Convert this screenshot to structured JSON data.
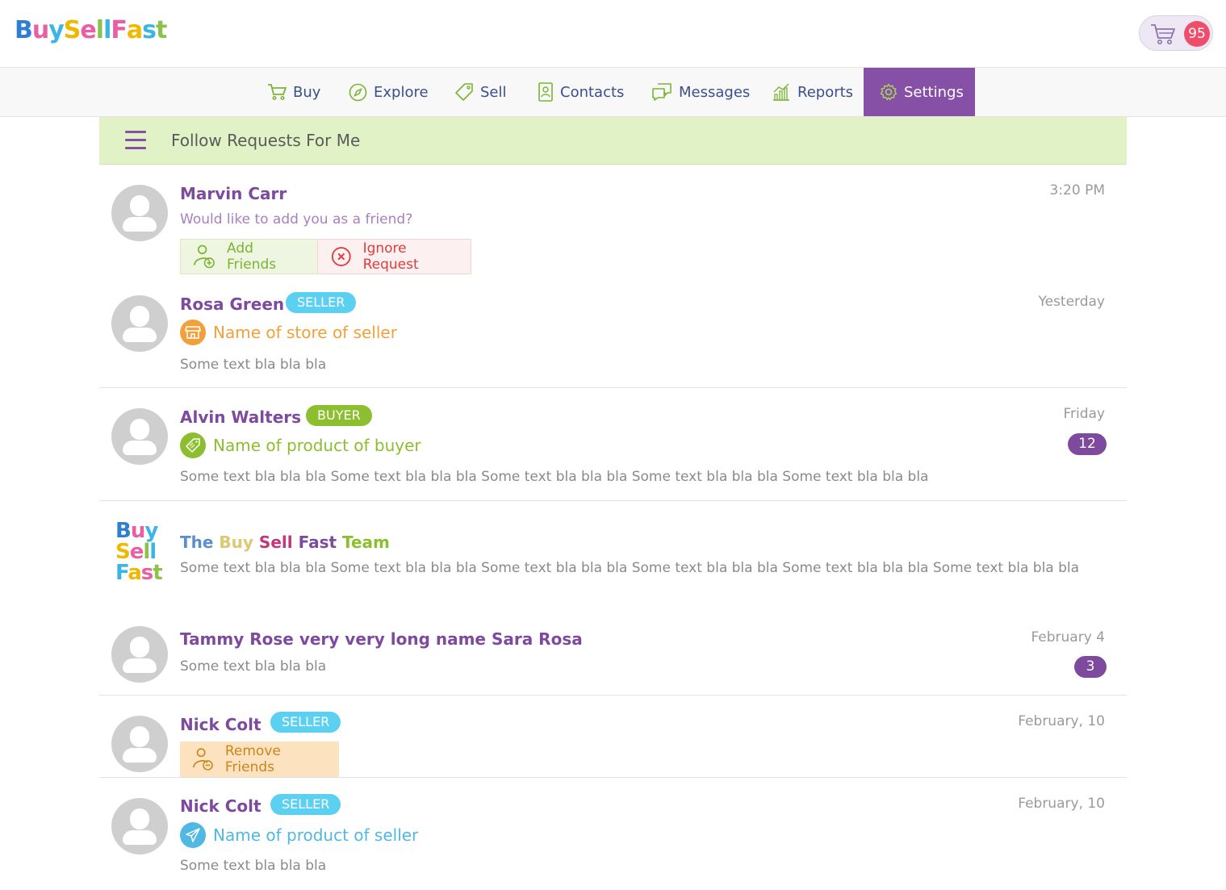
{
  "header": {
    "logo": [
      "B",
      "u",
      "y",
      "S",
      "e",
      "l",
      "l",
      "F",
      "a",
      "s",
      "t"
    ],
    "logo_colors": [
      "#2e7fd2",
      "#e85fa3",
      "#3ab6e6",
      "#f0b800",
      "#e85fa3",
      "#8bc34a",
      "#3ab6e6",
      "#e85fa3",
      "#f0b800",
      "#3ab6e6",
      "#8bc34a"
    ],
    "cart_count": "95"
  },
  "nav": {
    "items": [
      {
        "label": "Buy",
        "icon": "cart-icon"
      },
      {
        "label": "Explore",
        "icon": "compass-icon"
      },
      {
        "label": "Sell",
        "icon": "tag-icon"
      },
      {
        "label": "Contacts",
        "icon": "contacts-icon"
      },
      {
        "label": "Messages",
        "icon": "messages-icon"
      },
      {
        "label": "Reports",
        "icon": "chart-icon"
      },
      {
        "label": "Settings",
        "icon": "gear-icon"
      }
    ],
    "active": "Settings"
  },
  "subheader": {
    "title": "Follow Requests For Me"
  },
  "rows": [
    {
      "name": "Marvin Carr",
      "time": "3:20 PM",
      "message": "Would like to add you as a friend?",
      "actions": {
        "add": "Add Friends",
        "ignore": "Ignore Request"
      }
    },
    {
      "name": "Rosa Green",
      "tag": "SELLER",
      "time": "Yesterday",
      "subline": "Name of store of seller",
      "text": "Some text bla bla bla"
    },
    {
      "name": "Alvin Walters",
      "tag": "BUYER",
      "time": "Friday",
      "count": "12",
      "subline": "Name of product of buyer",
      "text": "Some text bla bla bla Some text bla bla bla Some text bla bla bla Some text bla bla bla Some text bla bla bla"
    },
    {
      "team_logo": [
        "Buy",
        "Sell",
        "Fast"
      ],
      "team_name": {
        "the": "The",
        "buy": "Buy",
        "sell": "Sell",
        "fast": "Fast",
        "team": "Team"
      },
      "text": "Some text bla bla bla Some text bla bla bla Some text bla bla bla Some text bla bla bla Some text bla bla bla Some text bla bla bla"
    },
    {
      "name": "Tammy Rose very very long name Sara Rosa",
      "time": "February 4",
      "count": "3",
      "text": "Some text bla bla bla"
    },
    {
      "name": "Nick Colt",
      "tag": "SELLER",
      "time": "February, 10",
      "actions": {
        "remove": "Remove Friends"
      }
    },
    {
      "name": "Nick Colt",
      "tag": "SELLER",
      "time": "February, 10",
      "subline": "Name of product of seller",
      "text": "Some text bla bla bla"
    }
  ],
  "colors": {
    "purple": "#7d4a9e",
    "active_nav": "#8650a6",
    "seller_tag": "#5cd0f0",
    "buyer_tag": "#8cbf2f",
    "subheader_bg": "#e1f2c6",
    "store_orange": "#f2a03a",
    "buyer_green": "#8cbf2f",
    "seller_blue": "#4fb8e3"
  }
}
